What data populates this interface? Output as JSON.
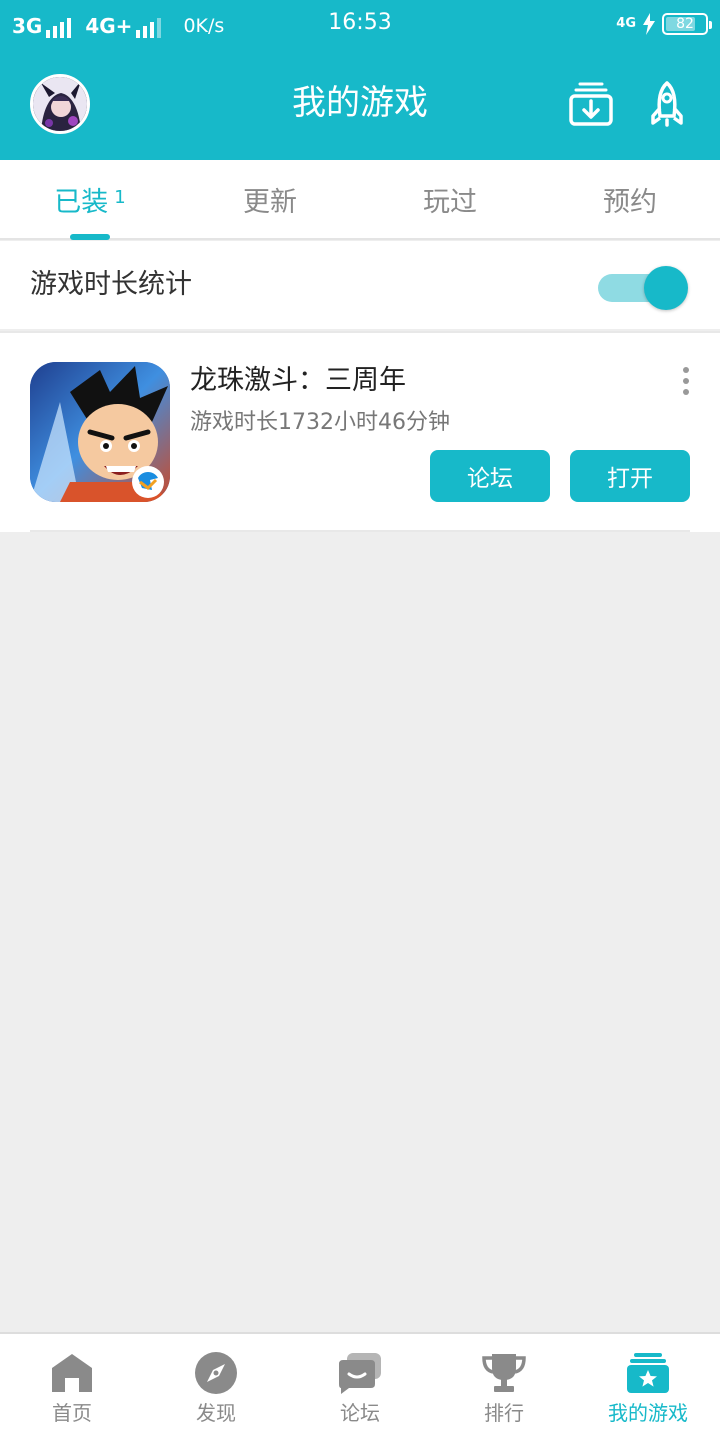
{
  "status_bar": {
    "network1": "3G",
    "network2": "4G+",
    "speed": "0K/s",
    "time": "16:53",
    "right_network": "4G",
    "battery": "82"
  },
  "header": {
    "title": "我的游戏",
    "icons": [
      "avatar",
      "download-icon",
      "rocket-icon"
    ]
  },
  "tabs": [
    {
      "label": "已装",
      "count": "1",
      "active": true
    },
    {
      "label": "更新",
      "count": "",
      "active": false
    },
    {
      "label": "玩过",
      "count": "",
      "active": false
    },
    {
      "label": "预约",
      "count": "",
      "active": false
    }
  ],
  "stats": {
    "label": "游戏时长统计",
    "enabled": true
  },
  "games": [
    {
      "name": "龙珠激斗：三周年",
      "playtime": "游戏时长1732小时46分钟",
      "forum_button": "论坛",
      "open_button": "打开"
    }
  ],
  "bottom_nav": [
    {
      "label": "首页",
      "icon": "home-icon",
      "active": false
    },
    {
      "label": "发现",
      "icon": "compass-icon",
      "active": false
    },
    {
      "label": "论坛",
      "icon": "chat-icon",
      "active": false
    },
    {
      "label": "排行",
      "icon": "trophy-icon",
      "active": false
    },
    {
      "label": "我的游戏",
      "icon": "my-games-icon",
      "active": true
    }
  ],
  "colors": {
    "accent": "#17b9c9",
    "background": "#eeeeee",
    "inactive": "#8a8a8a"
  }
}
